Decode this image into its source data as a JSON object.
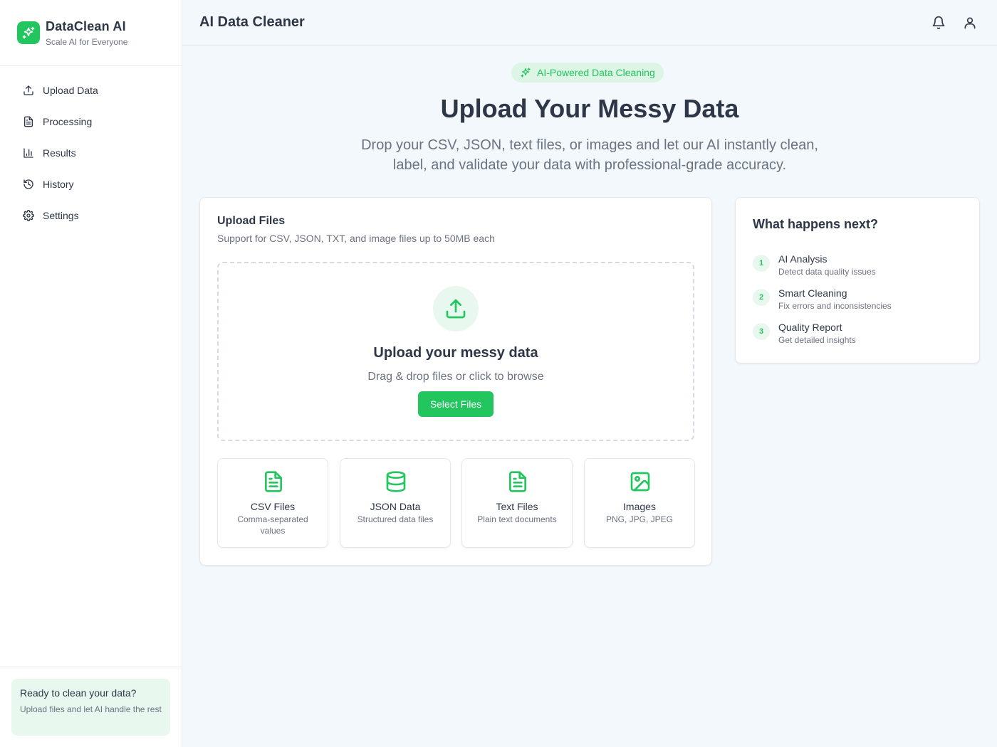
{
  "brand": {
    "name": "DataClean AI",
    "tagline": "Scale AI for Everyone"
  },
  "sidebar": {
    "items": [
      {
        "label": "Upload Data",
        "icon": "upload-icon"
      },
      {
        "label": "Processing",
        "icon": "document-icon"
      },
      {
        "label": "Results",
        "icon": "bar-chart-icon"
      },
      {
        "label": "History",
        "icon": "history-icon"
      },
      {
        "label": "Settings",
        "icon": "gear-icon"
      }
    ],
    "promo": {
      "title": "Ready to clean your data?",
      "text": "Upload files and let AI handle the rest"
    }
  },
  "header": {
    "title": "AI Data Cleaner",
    "icons": [
      "bell-icon",
      "user-icon"
    ]
  },
  "hero": {
    "badge": "AI-Powered Data Cleaning",
    "title": "Upload Your Messy Data",
    "subtitle": "Drop your CSV, JSON, text files, or images and let our AI instantly clean, label, and validate your data with professional-grade accuracy."
  },
  "upload": {
    "title": "Upload Files",
    "description": "Support for CSV, JSON, TXT, and image files up to 50MB each",
    "dropzone_title": "Upload your messy data",
    "dropzone_subtitle": "Drag & drop files or click to browse",
    "button_label": "Select Files",
    "types": [
      {
        "name": "CSV Files",
        "desc": "Comma-separated values",
        "icon": "file-text-icon"
      },
      {
        "name": "JSON Data",
        "desc": "Structured data files",
        "icon": "database-icon"
      },
      {
        "name": "Text Files",
        "desc": "Plain text documents",
        "icon": "file-text-icon"
      },
      {
        "name": "Images",
        "desc": "PNG, JPG, JPEG",
        "icon": "image-icon"
      }
    ]
  },
  "next": {
    "title": "What happens next?",
    "steps": [
      {
        "num": "1",
        "name": "AI Analysis",
        "desc": "Detect data quality issues"
      },
      {
        "num": "2",
        "name": "Smart Cleaning",
        "desc": "Fix errors and inconsistencies"
      },
      {
        "num": "3",
        "name": "Quality Report",
        "desc": "Get detailed insights"
      }
    ]
  },
  "colors": {
    "accent": "#22c55e",
    "accent_light": "#e8f8ee",
    "text": "#2e3748",
    "muted": "#6b7280",
    "background": "#f3f8fc"
  }
}
